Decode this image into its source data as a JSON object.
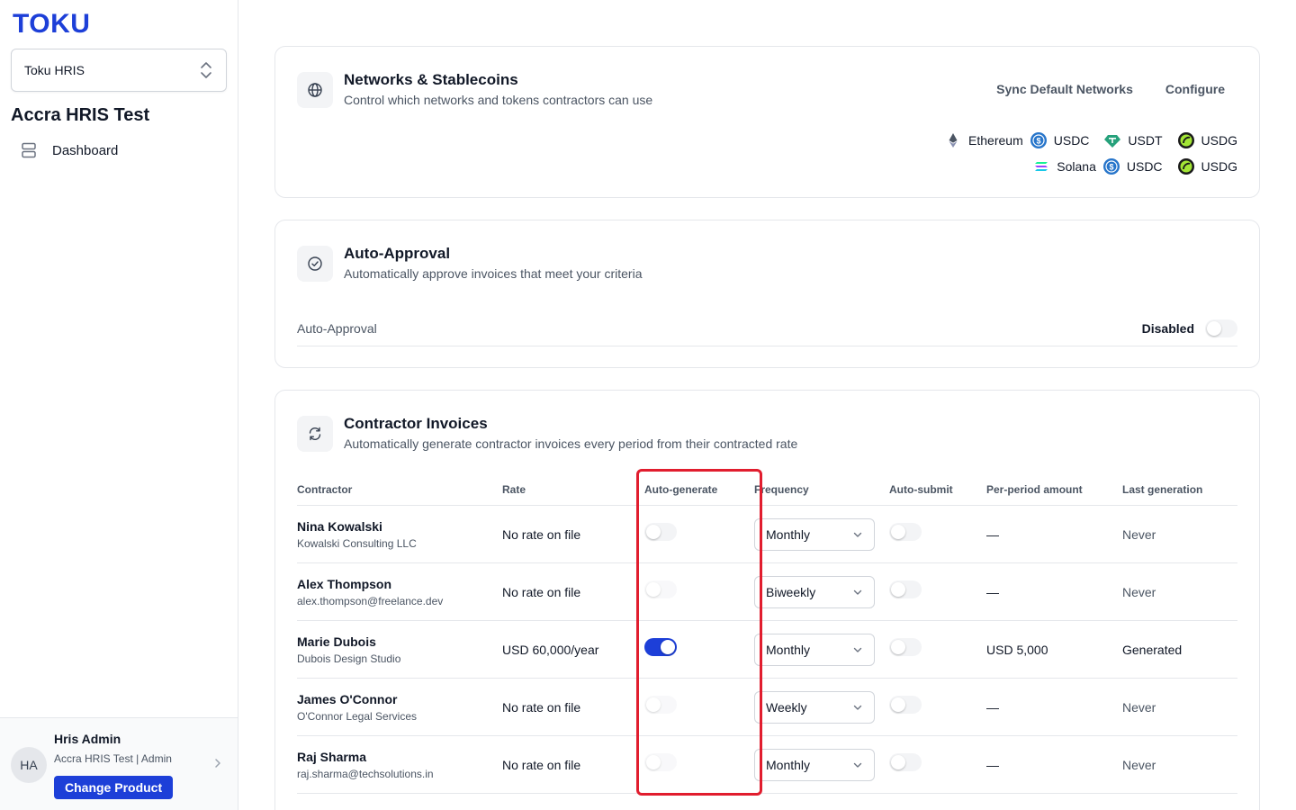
{
  "sidebar": {
    "logo": "TOKU",
    "product_select": "Toku HRIS",
    "org_title": "Accra HRIS Test",
    "nav": [
      {
        "label": "Dashboard",
        "icon": "database-icon"
      }
    ],
    "user": {
      "initials": "HA",
      "name": "Hris Admin",
      "subtitle": "Accra HRIS Test | Admin",
      "change_product": "Change Product"
    }
  },
  "networks": {
    "title": "Networks & Stablecoins",
    "description": "Control which networks and tokens contractors can use",
    "sync_label": "Sync Default Networks",
    "configure_label": "Configure",
    "rows": [
      {
        "network": "Ethereum",
        "tokens": [
          "USDC",
          "USDT",
          "USDG"
        ]
      },
      {
        "network": "Solana",
        "tokens": [
          "USDC",
          "USDG"
        ]
      }
    ]
  },
  "auto_approval": {
    "title": "Auto-Approval",
    "description": "Automatically approve invoices that meet your criteria",
    "label": "Auto-Approval",
    "status": "Disabled",
    "enabled": false
  },
  "contractor_invoices": {
    "title": "Contractor Invoices",
    "description": "Automatically generate contractor invoices every period from their contracted rate",
    "columns": [
      "Contractor",
      "Rate",
      "Auto-generate",
      "Frequency",
      "Auto-submit",
      "Per-period amount",
      "Last generation"
    ],
    "rows": [
      {
        "name": "Nina Kowalski",
        "sub": "Kowalski Consulting LLC",
        "rate": "No rate on file",
        "auto_generate": false,
        "frequency": "Monthly",
        "auto_submit": false,
        "amount": "—",
        "last": "Never"
      },
      {
        "name": "Alex Thompson",
        "sub": "alex.thompson@freelance.dev",
        "rate": "No rate on file",
        "auto_generate": false,
        "frequency": "Biweekly",
        "auto_submit": false,
        "amount": "—",
        "last": "Never"
      },
      {
        "name": "Marie Dubois",
        "sub": "Dubois Design Studio",
        "rate": "USD 60,000/year",
        "auto_generate": true,
        "frequency": "Monthly",
        "auto_submit": false,
        "amount": "USD 5,000",
        "last": "Generated"
      },
      {
        "name": "James O'Connor",
        "sub": "O'Connor Legal Services",
        "rate": "No rate on file",
        "auto_generate": false,
        "frequency": "Weekly",
        "auto_submit": false,
        "amount": "—",
        "last": "Never"
      },
      {
        "name": "Raj Sharma",
        "sub": "raj.sharma@techsolutions.in",
        "rate": "No rate on file",
        "auto_generate": false,
        "frequency": "Monthly",
        "auto_submit": false,
        "amount": "—",
        "last": "Never"
      }
    ]
  },
  "colors": {
    "brand": "#1d3fd8",
    "highlight": "#e11d2e",
    "usdc": "#2775ca",
    "usdt": "#26a17b",
    "usdg": "#1a1a1a"
  }
}
